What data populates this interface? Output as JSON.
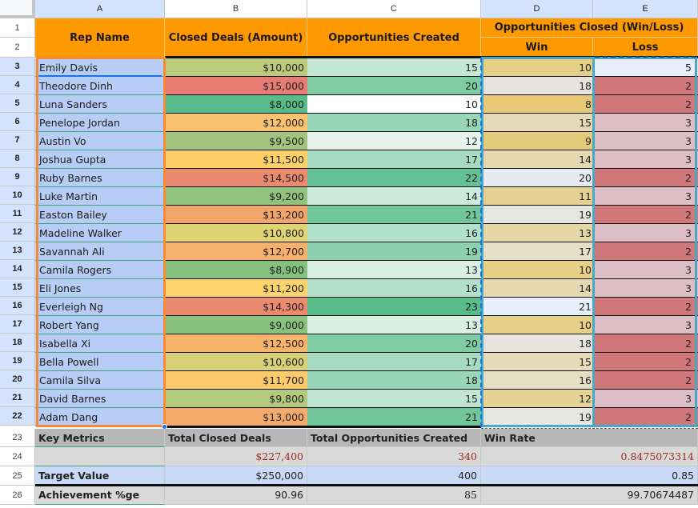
{
  "columns": [
    "A",
    "B",
    "C",
    "D",
    "E"
  ],
  "row_numbers": [
    "1",
    "2",
    "3",
    "4",
    "5",
    "6",
    "7",
    "8",
    "9",
    "10",
    "11",
    "12",
    "13",
    "14",
    "15",
    "16",
    "17",
    "18",
    "19",
    "20",
    "21",
    "22",
    "23",
    "24",
    "25",
    "26"
  ],
  "header": {
    "rep_name": "Rep Name",
    "closed_deals": "Closed Deals (Amount)",
    "opportunities_created": "Opportunities Created",
    "opportunities_closed": "Opportunities Closed (Win/Loss)",
    "win": "Win",
    "loss": "Loss"
  },
  "rows": [
    {
      "name": "Emily Davis",
      "amount": "$10,000",
      "created": "15",
      "win": "10",
      "loss": "5",
      "colors": {
        "amount": "#bccb7b",
        "created": "#c3e6d5",
        "win": "#e6cf86",
        "loss": "#e8eefb"
      }
    },
    {
      "name": "Theodore Dinh",
      "amount": "$15,000",
      "created": "20",
      "win": "18",
      "loss": "2",
      "colors": {
        "amount": "#e67c73",
        "created": "#7fcca4",
        "win": "#e6e4dc",
        "loss": "#d0777a"
      }
    },
    {
      "name": "Luna Sanders",
      "amount": "$8,000",
      "created": "10",
      "win": "8",
      "loss": "2",
      "colors": {
        "amount": "#57bb8a",
        "created": "#ffffff",
        "win": "#e6c877",
        "loss": "#d0777a"
      }
    },
    {
      "name": "Penelope Jordan",
      "amount": "$12,000",
      "created": "18",
      "win": "15",
      "loss": "3",
      "colors": {
        "amount": "#fac26e",
        "created": "#99d6b7",
        "win": "#e6dab6",
        "loss": "#ddbec6"
      }
    },
    {
      "name": "Austin Vo",
      "amount": "$9,500",
      "created": "12",
      "win": "9",
      "loss": "3",
      "colors": {
        "amount": "#a2c47e",
        "created": "#e6f4ed",
        "win": "#e6ca7b",
        "loss": "#ddbec6"
      }
    },
    {
      "name": "Joshua Gupta",
      "amount": "$11,500",
      "created": "17",
      "win": "14",
      "loss": "3",
      "colors": {
        "amount": "#fdd06a",
        "created": "#a6dbc1",
        "win": "#e6d8b0",
        "loss": "#ddbec6"
      }
    },
    {
      "name": "Ruby Barnes",
      "amount": "$14,500",
      "created": "22",
      "win": "20",
      "loss": "2",
      "colors": {
        "amount": "#ea8a6f",
        "created": "#64c095",
        "win": "#e6ebf2",
        "loss": "#d0777a"
      }
    },
    {
      "name": "Luke Martin",
      "amount": "$9,200",
      "created": "14",
      "win": "11",
      "loss": "3",
      "colors": {
        "amount": "#91c27e",
        "created": "#cdebdc",
        "win": "#e6d091",
        "loss": "#ddbec6"
      }
    },
    {
      "name": "Easton Bailey",
      "amount": "$13,200",
      "created": "21",
      "win": "19",
      "loss": "2",
      "colors": {
        "amount": "#f2a56a",
        "created": "#72c69b",
        "win": "#e6e6e2",
        "loss": "#d0777a"
      }
    },
    {
      "name": "Madeline Walker",
      "amount": "$10,800",
      "created": "16",
      "win": "13",
      "loss": "3",
      "colors": {
        "amount": "#e0d474",
        "created": "#b3e0ca",
        "win": "#e6d7a8",
        "loss": "#ddbec6"
      }
    },
    {
      "name": "Savannah Ali",
      "amount": "$12,700",
      "created": "19",
      "win": "17",
      "loss": "2",
      "colors": {
        "amount": "#f6b06b",
        "created": "#8cd0af",
        "win": "#e6e0c6",
        "loss": "#d0777a"
      }
    },
    {
      "name": "Camila Rogers",
      "amount": "$8,900",
      "created": "13",
      "win": "10",
      "loss": "3",
      "colors": {
        "amount": "#86c07f",
        "created": "#d9efe4",
        "win": "#e6cf86",
        "loss": "#ddbec6"
      }
    },
    {
      "name": "Eli Jones",
      "amount": "$11,200",
      "created": "16",
      "win": "14",
      "loss": "3",
      "colors": {
        "amount": "#fcd46c",
        "created": "#b3e0ca",
        "win": "#e6d8b0",
        "loss": "#ddbec6"
      }
    },
    {
      "name": "Everleigh Ng",
      "amount": "$14,300",
      "created": "23",
      "win": "21",
      "loss": "2",
      "colors": {
        "amount": "#ea8a6f",
        "created": "#57bb8a",
        "win": "#e6effb",
        "loss": "#d0777a"
      }
    },
    {
      "name": "Robert Yang",
      "amount": "$9,000",
      "created": "13",
      "win": "10",
      "loss": "3",
      "colors": {
        "amount": "#89c27e",
        "created": "#d9efe4",
        "win": "#e6cf86",
        "loss": "#ddbec6"
      }
    },
    {
      "name": "Isabella Xi",
      "amount": "$12,500",
      "created": "20",
      "win": "18",
      "loss": "2",
      "colors": {
        "amount": "#f8b46b",
        "created": "#7fcca4",
        "win": "#e6e4dc",
        "loss": "#d0777a"
      }
    },
    {
      "name": "Bella Powell",
      "amount": "$10,600",
      "created": "17",
      "win": "15",
      "loss": "2",
      "colors": {
        "amount": "#d8d076",
        "created": "#a6dbc1",
        "win": "#e6dcba",
        "loss": "#d0777a"
      }
    },
    {
      "name": "Camila Silva",
      "amount": "$11,700",
      "created": "18",
      "win": "16",
      "loss": "2",
      "colors": {
        "amount": "#fdca6b",
        "created": "#99d6b7",
        "win": "#e6dfc4",
        "loss": "#d0777a"
      }
    },
    {
      "name": "David Barnes",
      "amount": "$9,800",
      "created": "15",
      "win": "12",
      "loss": "3",
      "colors": {
        "amount": "#b3c97b",
        "created": "#c0e5d3",
        "win": "#e6d396",
        "loss": "#ddbec6"
      }
    },
    {
      "name": "Adam Dang",
      "amount": "$13,000",
      "created": "21",
      "win": "19",
      "loss": "2",
      "colors": {
        "amount": "#f4aa6b",
        "created": "#72c69b",
        "win": "#e6e6e2",
        "loss": "#d0777a"
      }
    }
  ],
  "metrics": {
    "headers": {
      "label": "Key Metrics",
      "total_closed": "Total Closed Deals",
      "total_created": "Total Opportunities Created",
      "win_rate": "Win Rate"
    },
    "actual": {
      "label": "",
      "total_closed": "$227,400",
      "total_created": "340",
      "win_rate": "0.8475073314"
    },
    "target": {
      "label": "Target Value",
      "total_closed": "$250,000",
      "total_created": "400",
      "win_rate": "0.85"
    },
    "achievement": {
      "label": "Achievement %ge",
      "total_closed": "90.96",
      "total_created": "85",
      "win_rate": "99.70674487"
    }
  },
  "accent_colors": {
    "header_orange": "#ff9900",
    "selection_orange": "#f98a35",
    "selection_teal": "#4aa8c4",
    "name_column_blue": "#b7cdf5"
  }
}
